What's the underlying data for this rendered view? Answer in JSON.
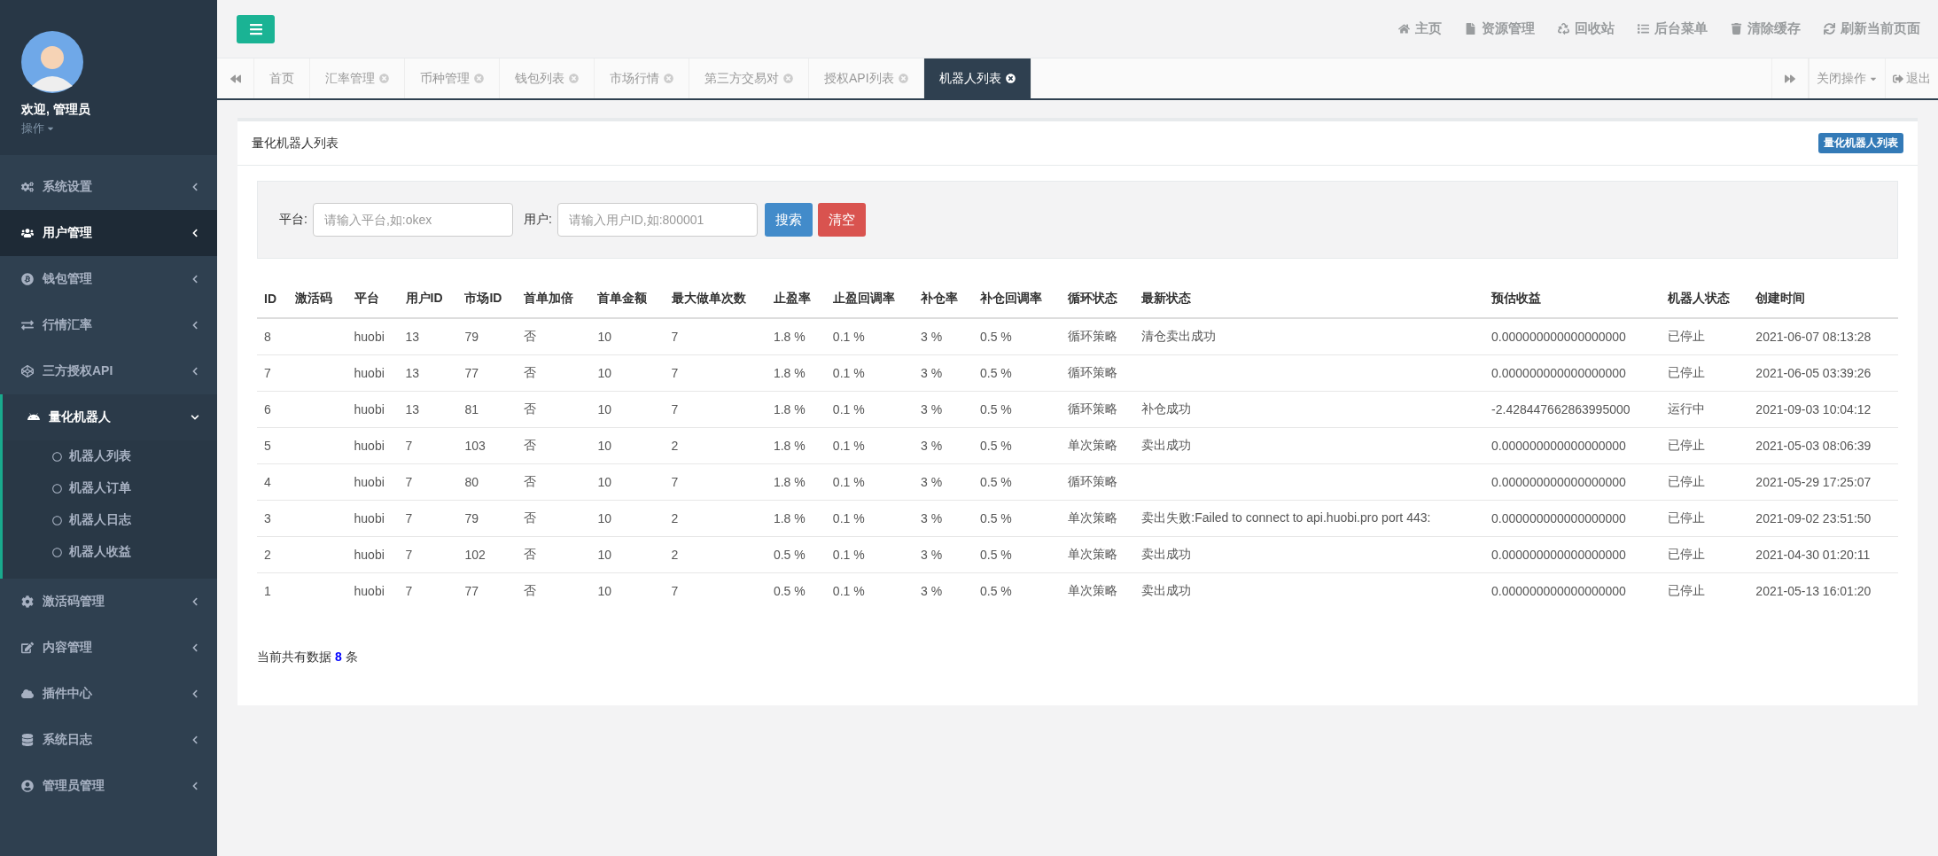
{
  "profile": {
    "greeting": "欢迎, 管理员",
    "menu_label": "操作"
  },
  "sidebar": {
    "items": [
      {
        "label": "系统设置",
        "selected": false,
        "expanded": false
      },
      {
        "label": "用户管理",
        "selected": true,
        "expanded": false
      },
      {
        "label": "钱包管理",
        "selected": false,
        "expanded": false
      },
      {
        "label": "行情汇率",
        "selected": false,
        "expanded": false
      },
      {
        "label": "三方授权API",
        "selected": false,
        "expanded": false
      },
      {
        "label": "量化机器人",
        "selected": false,
        "expanded": true,
        "children": [
          {
            "label": "机器人列表"
          },
          {
            "label": "机器人订单"
          },
          {
            "label": "机器人日志"
          },
          {
            "label": "机器人收益"
          }
        ]
      },
      {
        "label": "激活码管理",
        "selected": false,
        "expanded": false
      },
      {
        "label": "内容管理",
        "selected": false,
        "expanded": false
      },
      {
        "label": "插件中心",
        "selected": false,
        "expanded": false
      },
      {
        "label": "系统日志",
        "selected": false,
        "expanded": false
      },
      {
        "label": "管理员管理",
        "selected": false,
        "expanded": false
      }
    ]
  },
  "top_links": [
    "主页",
    "资源管理",
    "回收站",
    "后台菜单",
    "清除缓存",
    "刷新当前页面"
  ],
  "tabs": [
    {
      "label": "首页",
      "closable": false,
      "selected": false
    },
    {
      "label": "汇率管理",
      "closable": true,
      "selected": false
    },
    {
      "label": "币种管理",
      "closable": true,
      "selected": false
    },
    {
      "label": "钱包列表",
      "closable": true,
      "selected": false
    },
    {
      "label": "市场行情",
      "closable": true,
      "selected": false
    },
    {
      "label": "第三方交易对",
      "closable": true,
      "selected": false
    },
    {
      "label": "授权API列表",
      "closable": true,
      "selected": false
    },
    {
      "label": "机器人列表",
      "closable": true,
      "selected": true
    }
  ],
  "tab_actions": {
    "close_menu": "关闭操作",
    "logout": "退出"
  },
  "panel": {
    "title": "量化机器人列表",
    "badge": "量化机器人列表"
  },
  "search": {
    "platform_label": "平台:",
    "platform_placeholder": "请输入平台,如:okex",
    "user_label": "用户:",
    "user_placeholder": "请输入用户ID,如:800001",
    "search_button": "搜索",
    "clear_button": "清空"
  },
  "table": {
    "columns": [
      "ID",
      "激活码",
      "平台",
      "用户ID",
      "市场ID",
      "首单加倍",
      "首单金额",
      "最大做单次数",
      "止盈率",
      "止盈回调率",
      "补仓率",
      "补仓回调率",
      "循环状态",
      "最新状态",
      "预估收益",
      "机器人状态",
      "创建时间"
    ],
    "rows": [
      [
        "8",
        "",
        "huobi",
        "13",
        "79",
        "否",
        "10",
        "7",
        "1.8 %",
        "0.1 %",
        "3 %",
        "0.5 %",
        "循环策略",
        "清仓卖出成功",
        "0.000000000000000000",
        "已停止",
        "2021-06-07 08:13:28"
      ],
      [
        "7",
        "",
        "huobi",
        "13",
        "77",
        "否",
        "10",
        "7",
        "1.8 %",
        "0.1 %",
        "3 %",
        "0.5 %",
        "循环策略",
        "",
        "0.000000000000000000",
        "已停止",
        "2021-06-05 03:39:26"
      ],
      [
        "6",
        "",
        "huobi",
        "13",
        "81",
        "否",
        "10",
        "7",
        "1.8 %",
        "0.1 %",
        "3 %",
        "0.5 %",
        "循环策略",
        "补仓成功",
        "-2.428447662863995000",
        "运行中",
        "2021-09-03 10:04:12"
      ],
      [
        "5",
        "",
        "huobi",
        "7",
        "103",
        "否",
        "10",
        "2",
        "1.8 %",
        "0.1 %",
        "3 %",
        "0.5 %",
        "单次策略",
        "卖出成功",
        "0.000000000000000000",
        "已停止",
        "2021-05-03 08:06:39"
      ],
      [
        "4",
        "",
        "huobi",
        "7",
        "80",
        "否",
        "10",
        "7",
        "1.8 %",
        "0.1 %",
        "3 %",
        "0.5 %",
        "循环策略",
        "",
        "0.000000000000000000",
        "已停止",
        "2021-05-29 17:25:07"
      ],
      [
        "3",
        "",
        "huobi",
        "7",
        "79",
        "否",
        "10",
        "2",
        "1.8 %",
        "0.1 %",
        "3 %",
        "0.5 %",
        "单次策略",
        "卖出失败:Failed to connect to api.huobi.pro port 443:",
        "0.000000000000000000",
        "已停止",
        "2021-09-02 23:51:50"
      ],
      [
        "2",
        "",
        "huobi",
        "7",
        "102",
        "否",
        "10",
        "2",
        "0.5 %",
        "0.1 %",
        "3 %",
        "0.5 %",
        "单次策略",
        "卖出成功",
        "0.000000000000000000",
        "已停止",
        "2021-04-30 01:20:11"
      ],
      [
        "1",
        "",
        "huobi",
        "7",
        "77",
        "否",
        "10",
        "7",
        "0.5 %",
        "0.1 %",
        "3 %",
        "0.5 %",
        "单次策略",
        "卖出成功",
        "0.000000000000000000",
        "已停止",
        "2021-05-13 16:01:20"
      ]
    ]
  },
  "footer": "当前共有数据 **8** 条"
}
